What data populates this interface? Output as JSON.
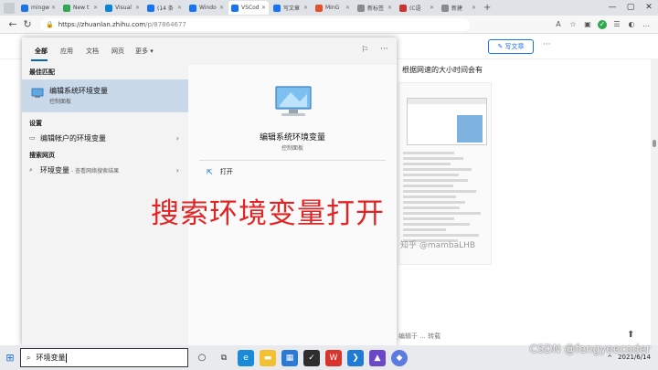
{
  "browser": {
    "tabs": [
      {
        "label": "mingw",
        "color": "#1a73e8"
      },
      {
        "label": "New t",
        "color": "#2fa84f"
      },
      {
        "label": "Visual",
        "color": "#0a84d8"
      },
      {
        "label": "(14 条",
        "color": "#1772f6"
      },
      {
        "label": "Windo",
        "color": "#1772f6"
      },
      {
        "label": "VSCod",
        "color": "#1772f6"
      },
      {
        "label": "写文章",
        "color": "#1772f6"
      },
      {
        "label": "MinG",
        "color": "#e2502c"
      },
      {
        "label": "新标签",
        "color": "#8a8a8a"
      },
      {
        "label": "(C语",
        "color": "#c33"
      },
      {
        "label": "新建",
        "color": "#8a8a8a"
      }
    ],
    "active_tab_index": 5,
    "url_host": "https://zhuanlan.zhihu.com",
    "url_path": "/p/87864677"
  },
  "page": {
    "write_button": "写文章",
    "article_text": "根据网速的大小时间会有",
    "watermark": "知乎 @mambaLHB",
    "more_link": "编辑于 ... 转载",
    "pub_date": "2021/6/14"
  },
  "search_panel": {
    "tabs": [
      "全部",
      "应用",
      "文档",
      "网页",
      "更多 ▾"
    ],
    "best_match_title": "最佳匹配",
    "best_match": {
      "name": "编辑系统环境变量",
      "sub": "控制面板"
    },
    "settings_title": "设置",
    "settings_item": "编辑帐户的环境变量",
    "web_title": "搜索网页",
    "web_item": "环境变量",
    "web_item_sub": "- 查看网络搜索结果",
    "detail_title": "编辑系统环境变量",
    "detail_sub": "控制面板",
    "open_label": "打开"
  },
  "overlay_caption": "搜索环境变量打开",
  "taskbar": {
    "search_text": "环境变量",
    "clock_time": "",
    "clock_date": "2021/6/14"
  },
  "csdn_watermark": "CSDN @fengyeecoder"
}
